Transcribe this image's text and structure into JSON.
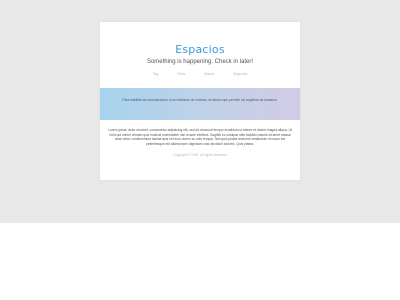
{
  "site": {
    "title": "Espacios",
    "tagline": "Something is happening. Check in later!"
  },
  "nav": {
    "items": [
      {
        "label": "Tag"
      },
      {
        "label": "Ruta"
      },
      {
        "label": "Marca"
      },
      {
        "label": "Segundo"
      }
    ]
  },
  "banner": {
    "text": "Para habilitar las suscripciones a los boletines de noticias, se tienen que permitir los registros de usuarios."
  },
  "content": {
    "paragraph": "Lorem ipsum dolor sit amet, consectetur adipiscing elit, sed do eiusmod tempor incididunt ut labore et dolore magna aliqua. Ut enim ad minim veniam quis nostrud exercitation nisi ut aute eleifend. Sagittis eu volutpat odio facilisis mauris sit amet massa vitae tortor condimentum lacinia quis vel eros donec ac odio tempor. Nisi quis platea dictumst vestibulum rhoncus est pellentesque elit ullamcorper dignissim cras tincidunt lobortis. Quis platea."
  },
  "footer": {
    "copyright": "Copyright © 2020. All rights reserved."
  },
  "colors": {
    "accent": "#3a9bd6",
    "banner_start": "#a7d3ee",
    "banner_end": "#d2cae6"
  }
}
